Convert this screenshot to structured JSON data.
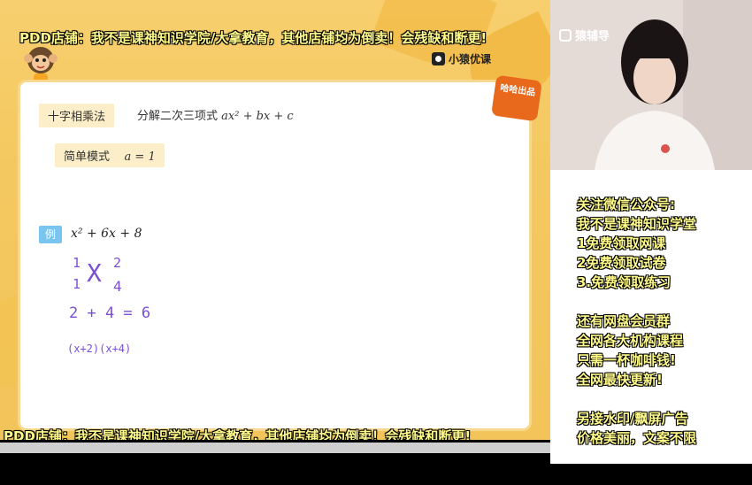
{
  "watermark": {
    "top_text": "PDD店铺：我不是课神知识学院/大拿教育，其他店铺均为倒卖！会残缺和断更!",
    "bottom_text": "PDD店铺：我不是课神知识学院/大拿教育，其他店铺均为倒卖！会残缺和断更!"
  },
  "brand": {
    "name": "小猿优课",
    "icon": "yuan-logo-icon"
  },
  "camera_logo": {
    "text": "猿辅导",
    "icon": "yuan-logo-icon"
  },
  "stamp": {
    "text": "哈哈出品"
  },
  "lesson": {
    "method_tag": "十字相乘法",
    "subtitle_prefix": "分解二次三项式",
    "subtitle_math": "ax² + bx + c",
    "mode_tag": "简单模式",
    "mode_math": "a = 1",
    "example_label": "例",
    "example_expr": "x² + 6x + 8"
  },
  "handwriting": {
    "cross_left_top": "1",
    "cross_left_bottom": "1",
    "cross_right_top": "2",
    "cross_right_bottom": "4",
    "cross_mark": "X",
    "sum": "2 + 4 = 6",
    "factored": "(x+2)(x+4)"
  },
  "ad_panel": {
    "lines": [
      "关注微信公众号:",
      "我不是课神知识学堂",
      "1免费领取网课",
      "2免费领取试卷",
      "3.免费领取练习",
      "还有网盘会员群",
      "全网各大机构课程",
      "只需一杯咖啡钱!",
      "全网最快更新!",
      "另接水印/飘屏广告",
      "价格美丽，文案不限"
    ]
  }
}
